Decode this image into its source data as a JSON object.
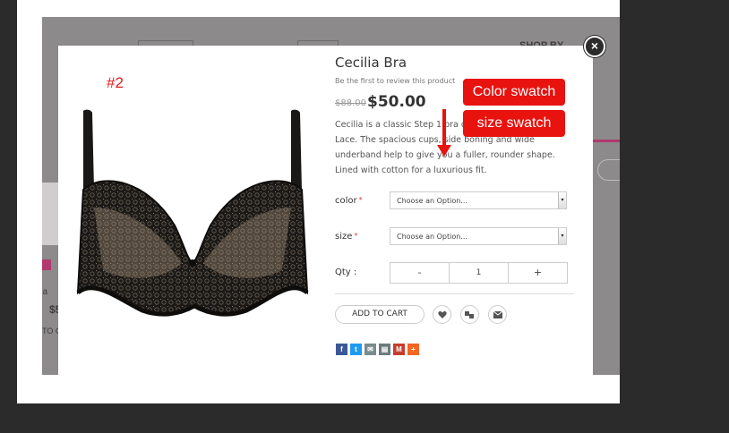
{
  "background": {
    "shop_by": "SHOP BY",
    "partial_name": "lia",
    "partial_price": "$5",
    "partial_button": "TO C"
  },
  "modal": {
    "image_label": "#2",
    "close_symbol": "×",
    "product": {
      "title": "Cecilia Bra",
      "review_link": "Be the first to review this product",
      "old_price": "$88.00",
      "price": "$50.00",
      "description": "Cecilia is a classic Step 1 bra design with a touch of Lace. The spacious cups, side boning and wide underband help to give you a fuller, rounder shape. Lined with cotton for a luxurious fit."
    },
    "options": {
      "color_label": "color",
      "size_label": "size",
      "required_mark": "*",
      "color_value": "Choose an Option...",
      "size_value": "Choose an Option...",
      "arrow": "▾"
    },
    "qty": {
      "label": "Qty :",
      "minus": "-",
      "value": "1",
      "plus": "+"
    },
    "actions": {
      "add_to_cart": "ADD TO CART"
    }
  },
  "annotations": {
    "color_swatch": "Color swatch",
    "size_swatch": "size swatch",
    "color": "#e8120f"
  },
  "share_icons": [
    "facebook-icon",
    "twitter-icon",
    "email-icon",
    "print-icon",
    "gmail-icon",
    "more-icon"
  ]
}
